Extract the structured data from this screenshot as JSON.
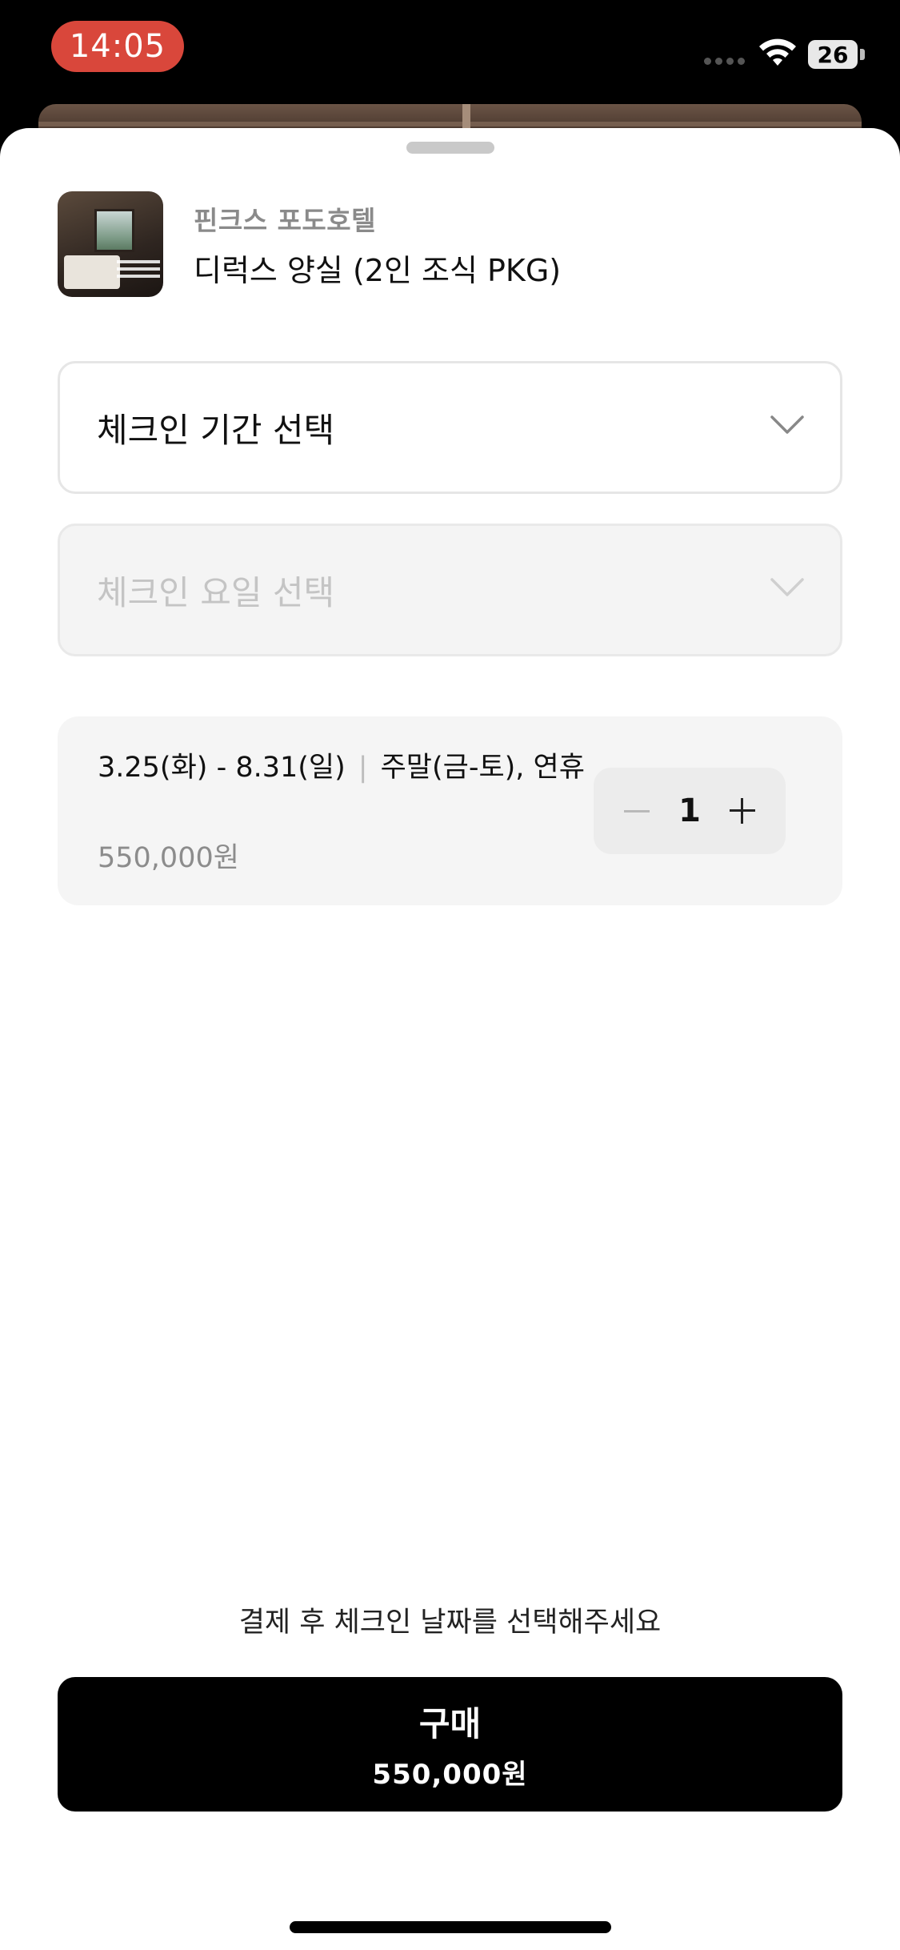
{
  "status_bar": {
    "time": "14:05",
    "battery": "26",
    "icons": [
      "signal-dots-icon",
      "wifi-icon",
      "battery-icon"
    ]
  },
  "product": {
    "brand": "핀크스 포도호텔",
    "name": "디럭스 양실 (2인 조식 PKG)"
  },
  "selects": {
    "period": {
      "label": "체크인 기간 선택",
      "enabled": true,
      "icon": "chevron-down-icon"
    },
    "weekday": {
      "label": "체크인 요일 선택",
      "enabled": false,
      "icon": "chevron-down-icon"
    }
  },
  "option": {
    "date_range": "3.25(화) - 8.31(일)",
    "separator": "|",
    "day_type": "주말(금-토), 연휴",
    "price": "550,000원",
    "quantity": "1"
  },
  "notice": "결제 후 체크인 날짜를 선택해주세요",
  "buy_button": {
    "label": "구매",
    "price": "550,000원"
  },
  "colors": {
    "time_pill": "#d9473b",
    "buy_button": "#000000",
    "card_bg": "#f5f5f5"
  }
}
